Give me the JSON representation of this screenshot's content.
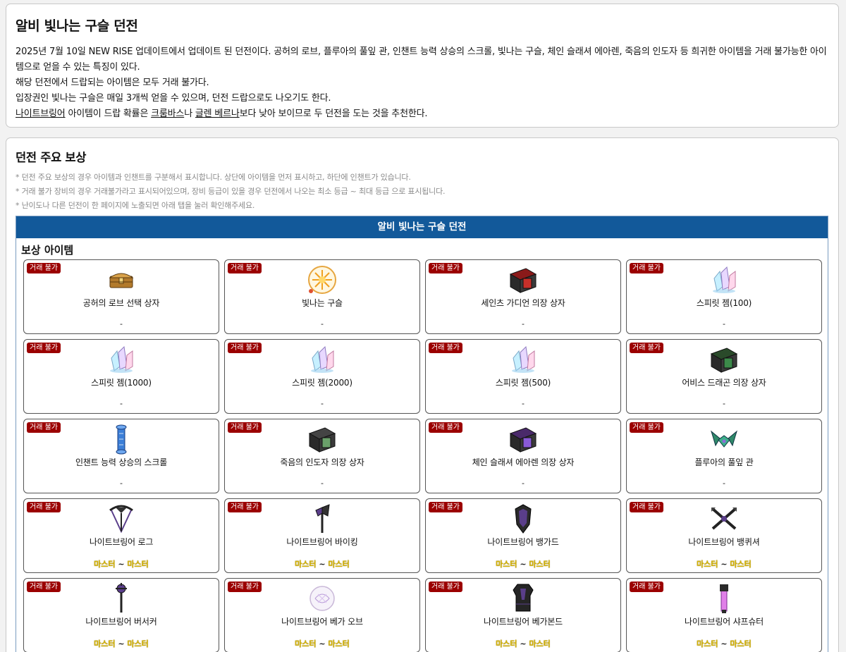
{
  "intro": {
    "title": "알비 빛나는 구슬 던전",
    "line1": "2025년 7월 10일 NEW RISE 업데이트에서 업데이트 된 던전이다. 공허의 로브, 플루아의 풀잎 관, 인챈트 능력 상승의 스크롤, 빛나는 구슬, 체인 슬래셔 에아렌, 죽음의 인도자 등 희귀한 아이템을 거래 불가능한 아이템으로 얻을 수 있는 특징이 있다.",
    "line2": "해당 던전에서 드랍되는 아이템은 모두 거래 불가다.",
    "line3": "입장권인 빛나는 구슬은 매일 3개씩 얻을 수 있으며, 던전 드랍으로도 나오기도 한다.",
    "line4_link1": "나이트브링어",
    "line4_part1": " 아이템이 드랍 확률은 ",
    "line4_link2": "크룸바스",
    "line4_part2": "나 ",
    "line4_link3": "글렌 베르나",
    "line4_part3": "보다 낮아 보이므로 두 던전을 도는 것을 추천한다."
  },
  "rewards": {
    "title": "던전 주요 보상",
    "notes": [
      "* 던전 주요 보상의 경우 아이템과 인챈트를 구분해서 표시합니다. 상단에 아이템을 먼저 표시하고, 하단에 인챈트가 있습니다.",
      "* 거래 불가 장비의 경우 거래불가라고 표시되어있으며, 장비 등급이 있을 경우 던전에서 나오는 최소 등급 ~ 최대 등급 으로 표시됩니다.",
      "* 난이도나 다른 던전이 한 페이지에 노출되면 아래 탭을 눌러 확인해주세요."
    ],
    "dungeon_name": "알비 빛나는 구슬 던전",
    "section_title": "보상 아이템",
    "badge_label": "거래 불가",
    "grade_min": "마스터",
    "grade_sep": " ~ ",
    "grade_max": "마스터",
    "items": [
      {
        "name": "공허의 로브 선택 상자",
        "grade": "-",
        "icon": "chest-icon"
      },
      {
        "name": "빛나는 구슬",
        "grade": "-",
        "icon": "orb-icon"
      },
      {
        "name": "세인츠 가디언 의장 상자",
        "grade": "-",
        "icon": "costume-box-red-icon"
      },
      {
        "name": "스피릿 젬(100)",
        "grade": "-",
        "icon": "spirit-gem-icon"
      },
      {
        "name": "스피릿 젬(1000)",
        "grade": "-",
        "icon": "spirit-gem-icon"
      },
      {
        "name": "스피릿 젬(2000)",
        "grade": "-",
        "icon": "spirit-gem-icon"
      },
      {
        "name": "스피릿 젬(500)",
        "grade": "-",
        "icon": "spirit-gem-icon"
      },
      {
        "name": "어비스 드래곤 의장 상자",
        "grade": "-",
        "icon": "costume-box-green-icon"
      },
      {
        "name": "인챈트 능력 상승의 스크롤",
        "grade": "-",
        "icon": "scroll-icon"
      },
      {
        "name": "죽음의 인도자 의장 상자",
        "grade": "-",
        "icon": "costume-box-dark-icon"
      },
      {
        "name": "체인 슬래셔 에아렌 의장 상자",
        "grade": "-",
        "icon": "costume-box-purple-icon"
      },
      {
        "name": "플루아의 풀잎 관",
        "grade": "-",
        "icon": "leaf-crown-icon"
      },
      {
        "name": "나이트브링어 로그",
        "grade": "master",
        "icon": "bow-icon"
      },
      {
        "name": "나이트브링어 바이킹",
        "grade": "master",
        "icon": "axe-icon"
      },
      {
        "name": "나이트브링어 뱅가드",
        "grade": "master",
        "icon": "shield-icon"
      },
      {
        "name": "나이트브링어 뱅퀴셔",
        "grade": "master",
        "icon": "crossed-blades-icon"
      },
      {
        "name": "나이트브링어 버서커",
        "grade": "master",
        "icon": "mace-icon"
      },
      {
        "name": "나이트브링어 베가 오브",
        "grade": "master",
        "icon": "vega-orb-icon"
      },
      {
        "name": "나이트브링어 베가본드",
        "grade": "master",
        "icon": "armor-icon"
      },
      {
        "name": "나이트브링어 샤프슈터",
        "grade": "master",
        "icon": "gun-icon"
      }
    ]
  }
}
